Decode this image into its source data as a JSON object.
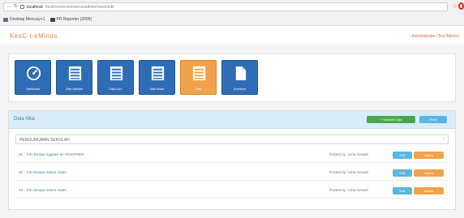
{
  "browser": {
    "url_host": "localhost",
    "url_path": "/test/cms/ecommerce/admin/news/edit",
    "bookmarks": [
      "Desktop Mercury+1",
      "PR Reporter (2000)"
    ]
  },
  "app": {
    "brand": "KesC I-eMinds",
    "user_link": "Administrator (Test Admin)"
  },
  "tiles": [
    {
      "label": "Dashboard",
      "icon": "dashboard-icon",
      "active": false
    },
    {
      "label": "Data Sekolah",
      "icon": "list-icon",
      "active": false
    },
    {
      "label": "Data Guru",
      "icon": "list-icon",
      "active": false
    },
    {
      "label": "Data Siswa",
      "icon": "list-icon",
      "active": false
    },
    {
      "label": "Data",
      "icon": "list-icon",
      "active": true
    },
    {
      "label": "Download",
      "icon": "file-icon",
      "active": false
    }
  ],
  "panel": {
    "title": "Data Nilai",
    "add_button": "+ Tambah Data",
    "print_button": "Print",
    "filter_label": "PENGUMUMAN SEKOLAH",
    "rows": [
      {
        "num": "01",
        "title": "Info kerapa nggawe ke ONSKRIEN",
        "status": "Posted by: Lima mewah"
      },
      {
        "num": "02",
        "title": "Info kerapa nalora mater",
        "status": "Posted by: Lima mewah"
      },
      {
        "num": "03",
        "title": "Info kerapa nalora mater",
        "status": "Posted by: Lima mewah"
      }
    ],
    "row_edit_label": "Edit",
    "row_delete_label": "Hapus"
  },
  "colors": {
    "tile_blue": "#2e6db5",
    "tile_active": "#f0a34a",
    "panel_head": "#d9ecf7",
    "brand": "#e0894a"
  }
}
